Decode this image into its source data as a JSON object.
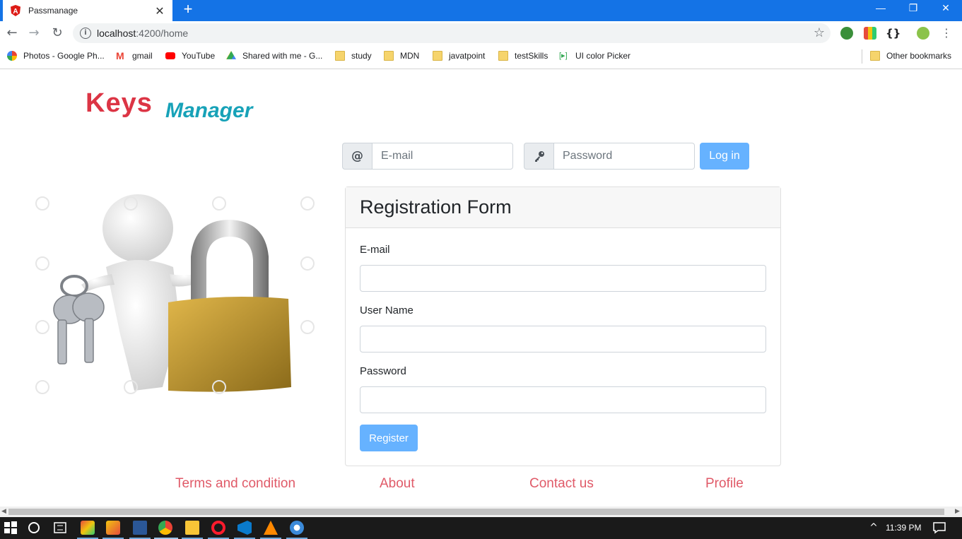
{
  "browser": {
    "tab_title": "Passmanage",
    "tab_close": "✕",
    "new_tab": "+",
    "minimize": "—",
    "restore": "❐",
    "close": "✕",
    "url_host": "localhost",
    "url_path": ":4200/home",
    "bookmarks": [
      {
        "label": "Photos - Google Ph...",
        "icon": "photos-icon"
      },
      {
        "label": "gmail",
        "icon": "gmail-icon"
      },
      {
        "label": "YouTube",
        "icon": "youtube-icon"
      },
      {
        "label": "Shared with me - G...",
        "icon": "drive-icon"
      },
      {
        "label": "study",
        "icon": "folder-icon"
      },
      {
        "label": "MDN",
        "icon": "folder-icon"
      },
      {
        "label": "javatpoint",
        "icon": "folder-icon"
      },
      {
        "label": "testSkills",
        "icon": "folder-icon"
      },
      {
        "label": "UI color Picker",
        "icon": "color-picker-icon"
      }
    ],
    "other_bookmarks": "Other bookmarks"
  },
  "header": {
    "logo_keys": "Keys",
    "logo_manager": "Manager",
    "email_prepend": "@",
    "email_placeholder": "E-mail",
    "password_placeholder": "Password",
    "login_label": "Log in"
  },
  "registration": {
    "title": "Registration Form",
    "email_label": "E-mail",
    "username_label": "User Name",
    "password_label": "Password",
    "register_label": "Register"
  },
  "footer": {
    "links": [
      "Terms and condition",
      "About",
      "Contact us",
      "Profile"
    ]
  },
  "taskbar": {
    "time": "11:39 PM"
  },
  "colors": {
    "accent": "#1473e6",
    "brand_red": "#dc3545",
    "brand_teal": "#17a2b8",
    "button_blue": "#66b2ff",
    "footer_link": "#e05a68"
  }
}
